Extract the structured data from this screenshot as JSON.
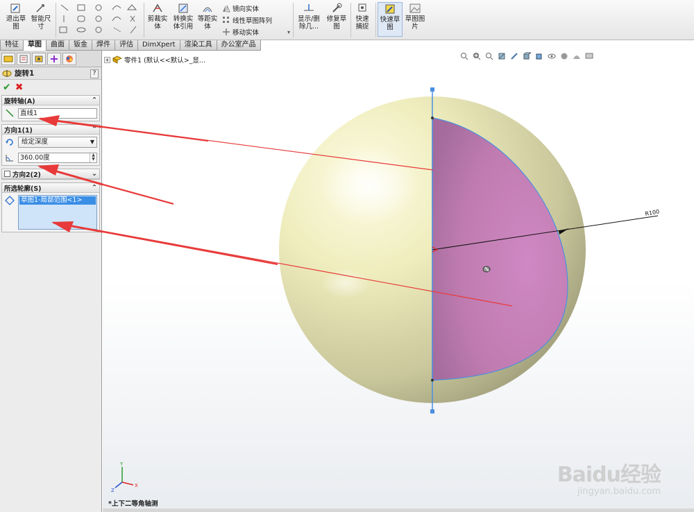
{
  "toolbar": {
    "exit_sketch": "退出草图",
    "smart_dim": "智能尺寸",
    "trim": "剪裁实体",
    "convert": "转换实体引用",
    "offset": "等距实体",
    "mirror": "镜向实体",
    "linear_pattern": "线性草图阵列",
    "move": "移动实体",
    "display_delete": "显示/删除几...",
    "repair": "修复草图",
    "quick_snap": "快速捕捉",
    "rapid_sketch": "快速草图",
    "sketch_picture": "草图图片"
  },
  "tabs": [
    "特征",
    "草图",
    "曲面",
    "钣金",
    "焊件",
    "评估",
    "DimXpert",
    "渲染工具",
    "办公室产品"
  ],
  "panel": {
    "title": "旋转1",
    "help": "?",
    "ok": "✔",
    "cancel": "✖",
    "axis_group": "旋转轴(A)",
    "axis_value": "直线1",
    "dir1_group": "方向1(1)",
    "dir1_type": "给定深度",
    "dir1_angle": "360.00度",
    "dir2_group": "方向2(2)",
    "contours_group": "所选轮廓(S)",
    "contour_item": "草图1-局部范围<1>"
  },
  "graphics": {
    "tree_label": "零件1 (默认<<默认>_显...",
    "dimension": "R100",
    "view_orientation": "*上下二等角轴测",
    "watermark_logo": "Baidu经验",
    "watermark_url": "jingyan.baidu.com",
    "triad_x": "X",
    "triad_y": "Y",
    "triad_z": "Z"
  },
  "colors": {
    "sphere": "#ecebb8",
    "section": "#cc85bf",
    "axis": "#4a8fe0",
    "arrow": "#e83a3a"
  }
}
